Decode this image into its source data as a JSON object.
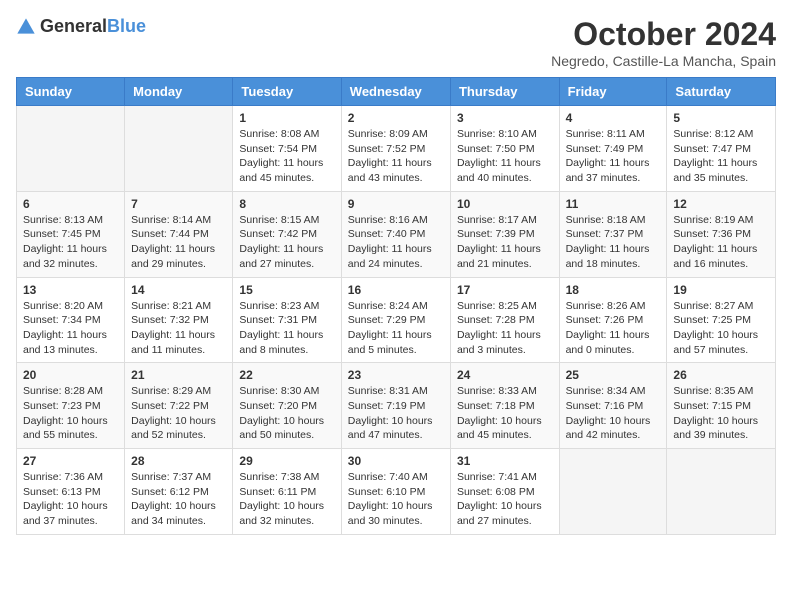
{
  "header": {
    "logo": {
      "general": "General",
      "blue": "Blue"
    },
    "title": "October 2024",
    "subtitle": "Negredo, Castille-La Mancha, Spain"
  },
  "weekdays": [
    "Sunday",
    "Monday",
    "Tuesday",
    "Wednesday",
    "Thursday",
    "Friday",
    "Saturday"
  ],
  "weeks": [
    [
      {
        "day": "",
        "info": ""
      },
      {
        "day": "",
        "info": ""
      },
      {
        "day": "1",
        "info": "Sunrise: 8:08 AM\nSunset: 7:54 PM\nDaylight: 11 hours and 45 minutes."
      },
      {
        "day": "2",
        "info": "Sunrise: 8:09 AM\nSunset: 7:52 PM\nDaylight: 11 hours and 43 minutes."
      },
      {
        "day": "3",
        "info": "Sunrise: 8:10 AM\nSunset: 7:50 PM\nDaylight: 11 hours and 40 minutes."
      },
      {
        "day": "4",
        "info": "Sunrise: 8:11 AM\nSunset: 7:49 PM\nDaylight: 11 hours and 37 minutes."
      },
      {
        "day": "5",
        "info": "Sunrise: 8:12 AM\nSunset: 7:47 PM\nDaylight: 11 hours and 35 minutes."
      }
    ],
    [
      {
        "day": "6",
        "info": "Sunrise: 8:13 AM\nSunset: 7:45 PM\nDaylight: 11 hours and 32 minutes."
      },
      {
        "day": "7",
        "info": "Sunrise: 8:14 AM\nSunset: 7:44 PM\nDaylight: 11 hours and 29 minutes."
      },
      {
        "day": "8",
        "info": "Sunrise: 8:15 AM\nSunset: 7:42 PM\nDaylight: 11 hours and 27 minutes."
      },
      {
        "day": "9",
        "info": "Sunrise: 8:16 AM\nSunset: 7:40 PM\nDaylight: 11 hours and 24 minutes."
      },
      {
        "day": "10",
        "info": "Sunrise: 8:17 AM\nSunset: 7:39 PM\nDaylight: 11 hours and 21 minutes."
      },
      {
        "day": "11",
        "info": "Sunrise: 8:18 AM\nSunset: 7:37 PM\nDaylight: 11 hours and 18 minutes."
      },
      {
        "day": "12",
        "info": "Sunrise: 8:19 AM\nSunset: 7:36 PM\nDaylight: 11 hours and 16 minutes."
      }
    ],
    [
      {
        "day": "13",
        "info": "Sunrise: 8:20 AM\nSunset: 7:34 PM\nDaylight: 11 hours and 13 minutes."
      },
      {
        "day": "14",
        "info": "Sunrise: 8:21 AM\nSunset: 7:32 PM\nDaylight: 11 hours and 11 minutes."
      },
      {
        "day": "15",
        "info": "Sunrise: 8:23 AM\nSunset: 7:31 PM\nDaylight: 11 hours and 8 minutes."
      },
      {
        "day": "16",
        "info": "Sunrise: 8:24 AM\nSunset: 7:29 PM\nDaylight: 11 hours and 5 minutes."
      },
      {
        "day": "17",
        "info": "Sunrise: 8:25 AM\nSunset: 7:28 PM\nDaylight: 11 hours and 3 minutes."
      },
      {
        "day": "18",
        "info": "Sunrise: 8:26 AM\nSunset: 7:26 PM\nDaylight: 11 hours and 0 minutes."
      },
      {
        "day": "19",
        "info": "Sunrise: 8:27 AM\nSunset: 7:25 PM\nDaylight: 10 hours and 57 minutes."
      }
    ],
    [
      {
        "day": "20",
        "info": "Sunrise: 8:28 AM\nSunset: 7:23 PM\nDaylight: 10 hours and 55 minutes."
      },
      {
        "day": "21",
        "info": "Sunrise: 8:29 AM\nSunset: 7:22 PM\nDaylight: 10 hours and 52 minutes."
      },
      {
        "day": "22",
        "info": "Sunrise: 8:30 AM\nSunset: 7:20 PM\nDaylight: 10 hours and 50 minutes."
      },
      {
        "day": "23",
        "info": "Sunrise: 8:31 AM\nSunset: 7:19 PM\nDaylight: 10 hours and 47 minutes."
      },
      {
        "day": "24",
        "info": "Sunrise: 8:33 AM\nSunset: 7:18 PM\nDaylight: 10 hours and 45 minutes."
      },
      {
        "day": "25",
        "info": "Sunrise: 8:34 AM\nSunset: 7:16 PM\nDaylight: 10 hours and 42 minutes."
      },
      {
        "day": "26",
        "info": "Sunrise: 8:35 AM\nSunset: 7:15 PM\nDaylight: 10 hours and 39 minutes."
      }
    ],
    [
      {
        "day": "27",
        "info": "Sunrise: 7:36 AM\nSunset: 6:13 PM\nDaylight: 10 hours and 37 minutes."
      },
      {
        "day": "28",
        "info": "Sunrise: 7:37 AM\nSunset: 6:12 PM\nDaylight: 10 hours and 34 minutes."
      },
      {
        "day": "29",
        "info": "Sunrise: 7:38 AM\nSunset: 6:11 PM\nDaylight: 10 hours and 32 minutes."
      },
      {
        "day": "30",
        "info": "Sunrise: 7:40 AM\nSunset: 6:10 PM\nDaylight: 10 hours and 30 minutes."
      },
      {
        "day": "31",
        "info": "Sunrise: 7:41 AM\nSunset: 6:08 PM\nDaylight: 10 hours and 27 minutes."
      },
      {
        "day": "",
        "info": ""
      },
      {
        "day": "",
        "info": ""
      }
    ]
  ]
}
